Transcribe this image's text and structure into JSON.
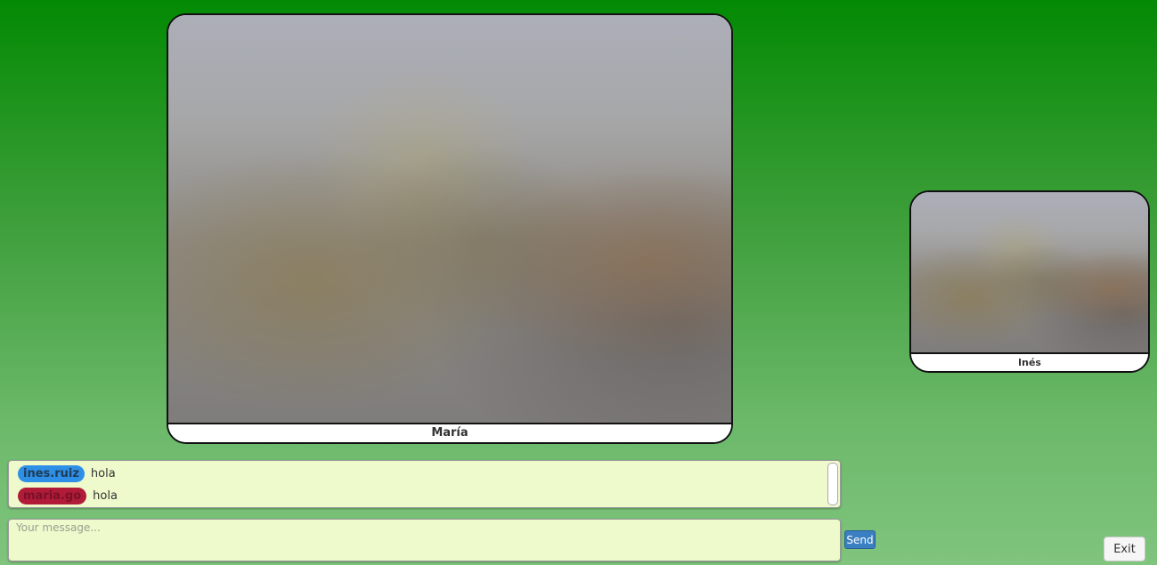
{
  "videos": {
    "main": {
      "name": "María"
    },
    "side": {
      "name": "Inés"
    }
  },
  "chat": {
    "messages": [
      {
        "user": "ines.ruiz",
        "user_color": "#2e8fe6",
        "text": "hola"
      },
      {
        "user": "maria.go",
        "user_color": "#b01b38",
        "text": "hola"
      }
    ]
  },
  "composer": {
    "placeholder": "Your message...",
    "send_label": "Send"
  },
  "exit_label": "Exit",
  "colors": {
    "background_top": "#038a03",
    "background_bottom": "#80c47e",
    "chat_bg": "#eef9cc",
    "send_button": "#3a7fc1"
  }
}
